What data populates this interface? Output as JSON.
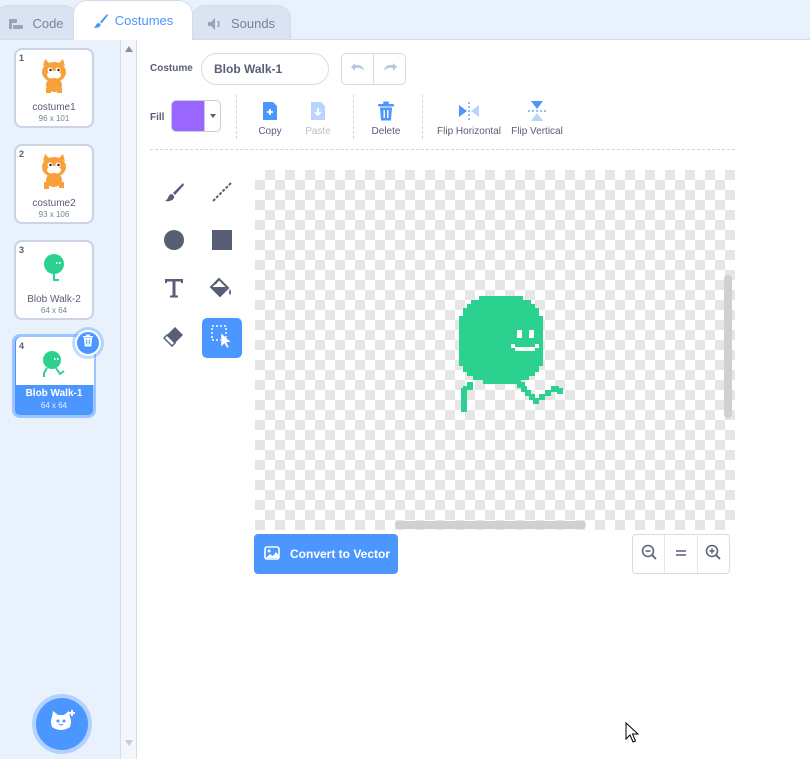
{
  "tabs": [
    {
      "label": "Code",
      "icon": "code-blocks-icon"
    },
    {
      "label": "Costumes",
      "icon": "paintbrush-icon",
      "active": true
    },
    {
      "label": "Sounds",
      "icon": "speaker-icon"
    }
  ],
  "costumes": [
    {
      "num": "1",
      "name": "costume1",
      "size": "96 x 101",
      "thumb": "cat-icon"
    },
    {
      "num": "2",
      "name": "costume2",
      "size": "93 x 106",
      "thumb": "cat-icon"
    },
    {
      "num": "3",
      "name": "Blob Walk-2",
      "size": "64 x 64",
      "thumb": "blob-icon"
    },
    {
      "num": "4",
      "name": "Blob Walk-1",
      "size": "64 x 64",
      "thumb": "blob-icon",
      "selected": true
    }
  ],
  "editor": {
    "costume_label": "Costume",
    "costume_name": "Blob Walk-1",
    "fill_label": "Fill",
    "fill_color": "#9966ff",
    "accent": "#4c97ff",
    "actions": {
      "copy": "Copy",
      "paste": "Paste",
      "delete": "Delete",
      "flip_horizontal": "Flip Horizontal",
      "flip_vertical": "Flip Vertical"
    },
    "convert_label": "Convert to Vector",
    "blob_color": "#2bd28f"
  }
}
